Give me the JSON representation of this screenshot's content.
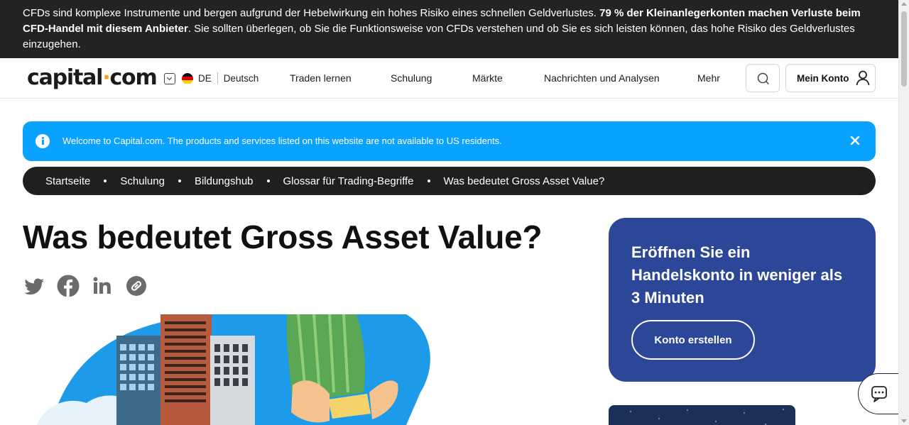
{
  "risk_banner": {
    "text_before": "CFDs sind komplexe Instrumente und bergen aufgrund der Hebelwirkung ein hohes Risiko eines schnellen Geldverlustes. ",
    "text_bold": "79 % der Kleinanlegerkonten machen Verluste beim CFD-Handel mit diesem Anbieter",
    "text_after": ". Sie sollten überlegen, ob Sie die Funktionsweise von CFDs verstehen und ob Sie es sich leisten können, das hohe Risiko des Geldverlustes einzugehen."
  },
  "header": {
    "logo_left": "capital",
    "logo_dot": "·",
    "logo_right": "com",
    "lang_code": "DE",
    "lang_name": "Deutsch",
    "nav": [
      "Traden lernen",
      "Schulung",
      "Märkte",
      "Nachrichten und Analysen",
      "Mehr"
    ],
    "account_label": "Mein Konto",
    "icons": {
      "search": "search-icon",
      "account": "user-icon",
      "lang": "chevron-down-icon",
      "flag": "germany-flag-icon"
    }
  },
  "alert": {
    "message": "Welcome to Capital.com. The products and services listed on this website are not available to US residents.",
    "color": "#0aa2ff"
  },
  "breadcrumb": [
    "Startseite",
    "Schulung",
    "Bildungshub",
    "Glossar für Trading-Begriffe",
    "Was bedeutet Gross Asset Value?"
  ],
  "page": {
    "title": "Was bedeutet Gross Asset Value?",
    "share_icons": [
      "twitter-icon",
      "facebook-icon",
      "linkedin-icon",
      "link-icon"
    ]
  },
  "cta": {
    "heading": "Eröffnen Sie ein Handelskonto in weniger als 3 Minuten",
    "button": "Konto erstellen",
    "color": "#2c4797"
  },
  "colors": {
    "banner": "#232323",
    "accent": "#f0a31a"
  }
}
